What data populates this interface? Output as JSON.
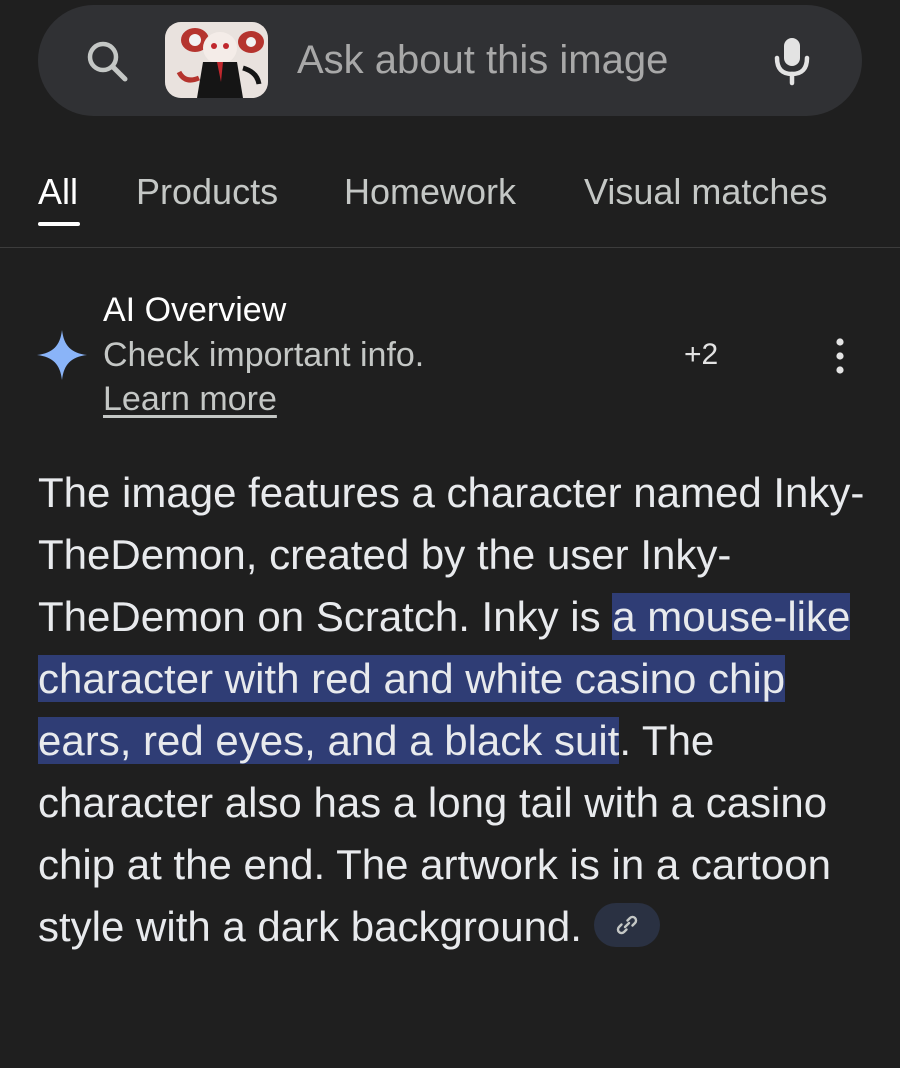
{
  "search": {
    "placeholder": "Ask about this image"
  },
  "icons": {
    "search": "search-icon",
    "mic": "mic-icon",
    "sparkle": "ai-sparkle-icon",
    "more": "more-vert-icon",
    "link": "link-icon"
  },
  "tabs": [
    {
      "label": "All",
      "active": true
    },
    {
      "label": "Products",
      "active": false
    },
    {
      "label": "Homework",
      "active": false
    },
    {
      "label": "Visual matches",
      "active": false
    }
  ],
  "ai_overview": {
    "title": "AI Overview",
    "notice": "Check important info.",
    "learn_more": "Learn more",
    "source_count": "+2",
    "text_before": "The image features a character named Inky-TheDemon, created by the user Inky-TheDemon on Scratch. Inky is ",
    "text_highlighted": "a mouse-like character with red and white casino chip ears, red eyes, and a black suit",
    "text_after": ". The character also has a long tail with a casino chip at the end. The artwork is in a cartoon style with a dark background."
  },
  "colors": {
    "background": "#1f1f1f",
    "search_bar": "#303134",
    "highlight": "#2f3d75",
    "sparkle": "#8ab4f8"
  }
}
